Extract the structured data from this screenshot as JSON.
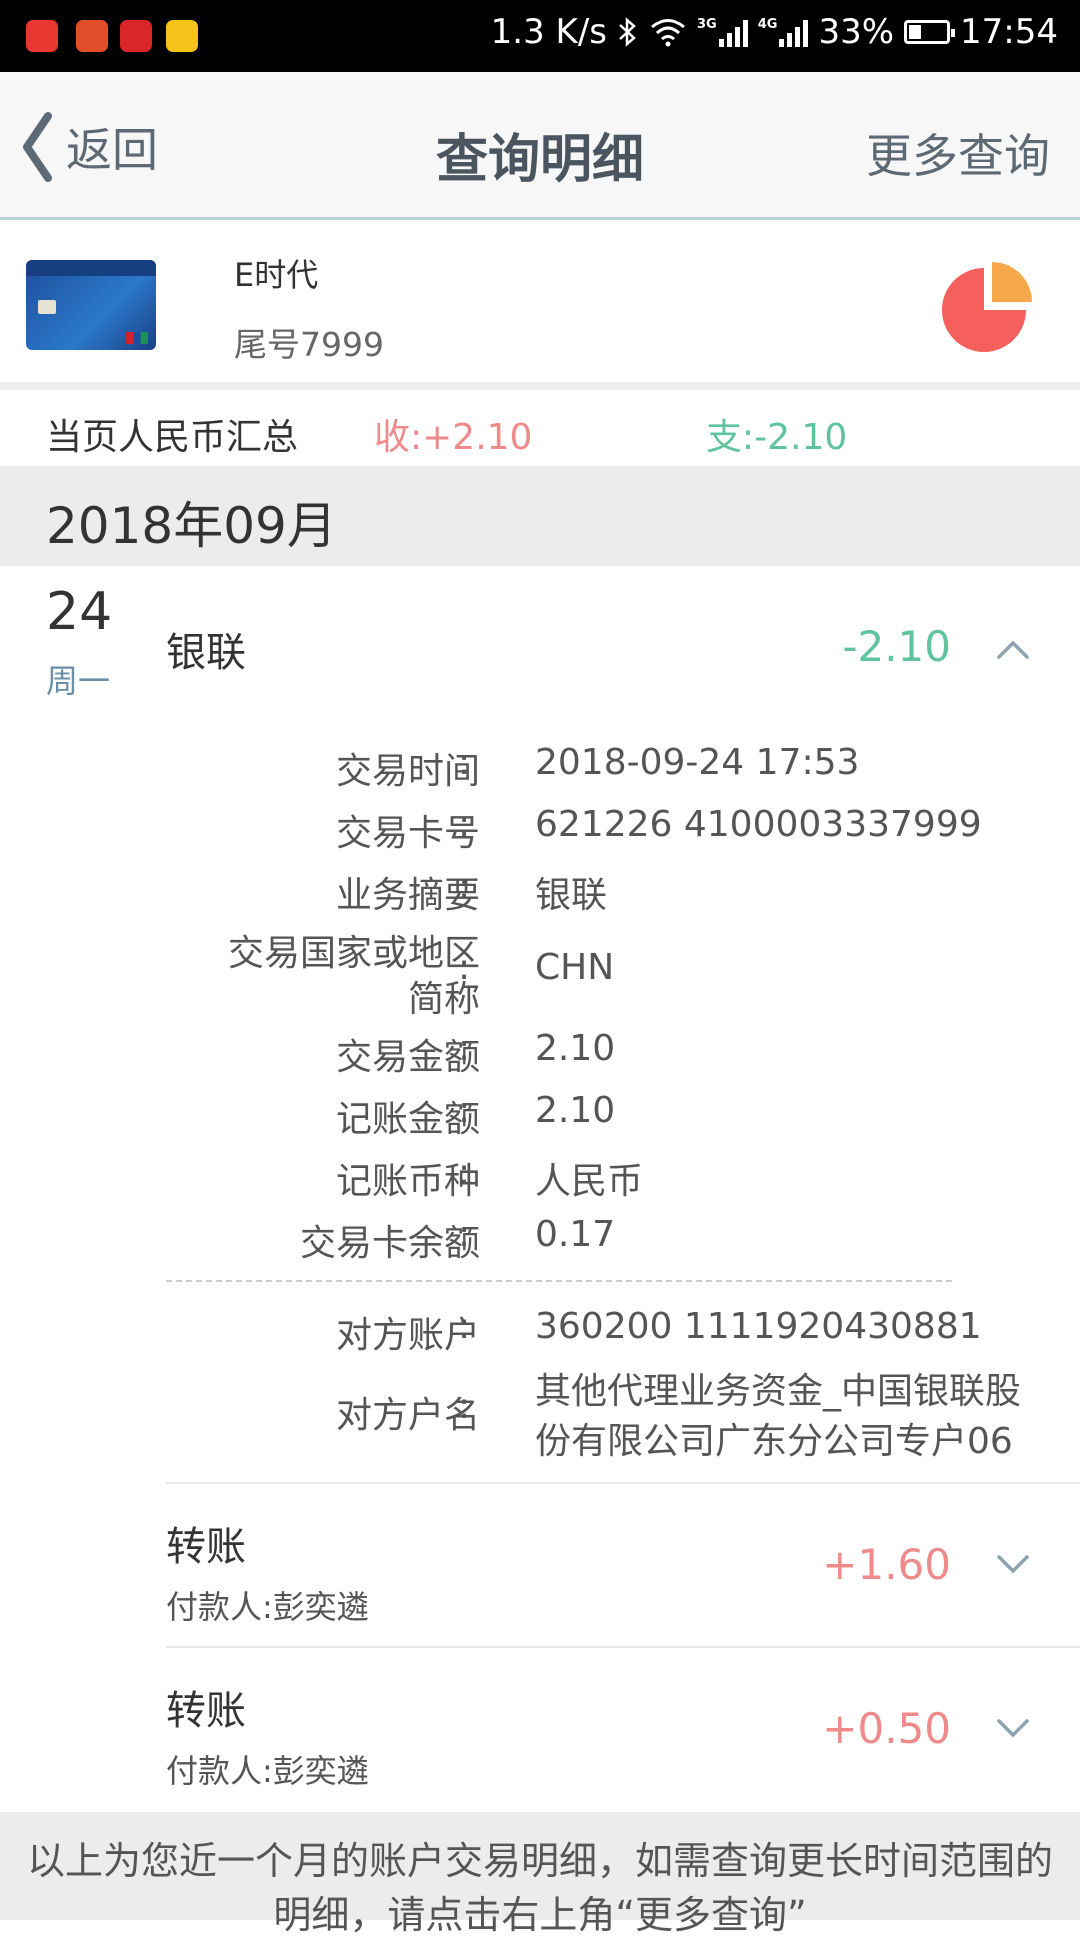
{
  "status_bar": {
    "speed": "1.3 K/s",
    "net1": "3G",
    "net2": "4G",
    "battery": "33%",
    "time": "17:54"
  },
  "header": {
    "back_label": "返回",
    "title": "查询明细",
    "more_label": "更多查询"
  },
  "card": {
    "name": "E时代",
    "tail": "尾号7999"
  },
  "summary": {
    "label": "当页人民币汇总",
    "income": "收:+2.10",
    "expense": "支:-2.10"
  },
  "month": "2018年09月",
  "day": {
    "date": "24",
    "weekday": "周一"
  },
  "transactions": [
    {
      "title": "银联",
      "amount": "-2.10"
    },
    {
      "title": "转账",
      "amount": "+1.60",
      "payer": "付款人:彭奕遴"
    },
    {
      "title": "转账",
      "amount": "+0.50",
      "payer": "付款人:彭奕遴"
    }
  ],
  "details": {
    "colon": ":",
    "rows": [
      {
        "label": "交易时间",
        "value": "2018-09-24 17:53"
      },
      {
        "label": "交易卡号",
        "value": "621226 4100003337999"
      },
      {
        "label": "业务摘要",
        "value": "银联"
      },
      {
        "label_line1": "交易国家或地区",
        "label_line2": "简称",
        "value": "CHN"
      },
      {
        "label": "交易金额",
        "value": "2.10"
      },
      {
        "label": "记账金额",
        "value": "2.10"
      },
      {
        "label": "记账币种",
        "value": "人民币"
      },
      {
        "label": "交易卡余额",
        "value": "0.17"
      },
      {
        "label": "对方账户",
        "value": "360200 1111920430881"
      },
      {
        "label": "对方户名",
        "value_line1": "其他代理业务资金_中国银联股",
        "value_line2": "份有限公司广东分公司专户06"
      }
    ]
  },
  "footer": {
    "text": "以上为您近一个月的账户交易明细，如需查询更长时间范围的明细，请点击右上角“更多查询”"
  },
  "colors": {
    "expense": "#5fc39d",
    "income": "#ef8a8a",
    "pie_main": "#f5605c",
    "pie_slice": "#f7a84a"
  }
}
